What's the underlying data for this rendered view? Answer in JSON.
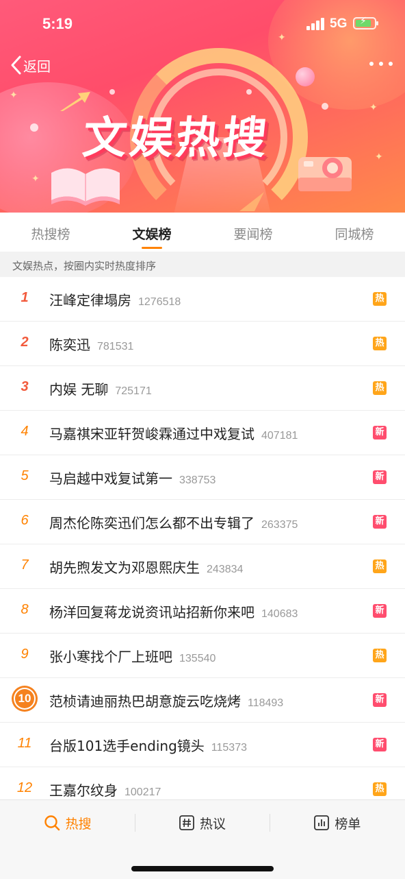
{
  "status_bar": {
    "time": "5:19",
    "network": "5G"
  },
  "header": {
    "back_label": "返回",
    "banner_title": "文娱热搜"
  },
  "tabs": [
    {
      "label": "热搜榜",
      "active": false
    },
    {
      "label": "文娱榜",
      "active": true
    },
    {
      "label": "要闻榜",
      "active": false
    },
    {
      "label": "同城榜",
      "active": false
    }
  ],
  "subheading": "文娱热点，按圈内实时热度排序",
  "list": [
    {
      "rank": "1",
      "title": "汪峰定律塌房",
      "count": "1276518",
      "badge": "热",
      "badge_type": "hot"
    },
    {
      "rank": "2",
      "title": "陈奕迅",
      "count": "781531",
      "badge": "热",
      "badge_type": "hot"
    },
    {
      "rank": "3",
      "title": "内娱 无聊",
      "count": "725171",
      "badge": "热",
      "badge_type": "hot"
    },
    {
      "rank": "4",
      "title": "马嘉祺宋亚轩贺峻霖通过中戏复试",
      "count": "407181",
      "badge": "新",
      "badge_type": "new"
    },
    {
      "rank": "5",
      "title": "马启越中戏复试第一",
      "count": "338753",
      "badge": "新",
      "badge_type": "new"
    },
    {
      "rank": "6",
      "title": "周杰伦陈奕迅们怎么都不出专辑了",
      "count": "263375",
      "badge": "新",
      "badge_type": "new"
    },
    {
      "rank": "7",
      "title": "胡先煦发文为邓恩熙庆生",
      "count": "243834",
      "badge": "热",
      "badge_type": "hot"
    },
    {
      "rank": "8",
      "title": "杨洋回复蒋龙说资讯站招新你来吧",
      "count": "140683",
      "badge": "新",
      "badge_type": "new"
    },
    {
      "rank": "9",
      "title": "张小寒找个厂上班吧",
      "count": "135540",
      "badge": "热",
      "badge_type": "hot"
    },
    {
      "rank": "10",
      "title": "范桢请迪丽热巴胡意旋云吃烧烤",
      "count": "118493",
      "badge": "新",
      "badge_type": "new"
    },
    {
      "rank": "11",
      "title": "台版101选手ending镜头",
      "count": "115373",
      "badge": "新",
      "badge_type": "new"
    },
    {
      "rank": "12",
      "title": "王嘉尔纹身",
      "count": "100217",
      "badge": "热",
      "badge_type": "hot"
    }
  ],
  "bottom_nav": [
    {
      "label": "热搜",
      "icon": "search-icon",
      "active": true
    },
    {
      "label": "热议",
      "icon": "hashtag-icon",
      "active": false
    },
    {
      "label": "榜单",
      "icon": "chart-icon",
      "active": false
    }
  ],
  "colors": {
    "accent": "#ff8200",
    "hot_badge": "#ffa51a",
    "new_badge": "#ff4d6e",
    "top_rank": "#f25a3c"
  }
}
